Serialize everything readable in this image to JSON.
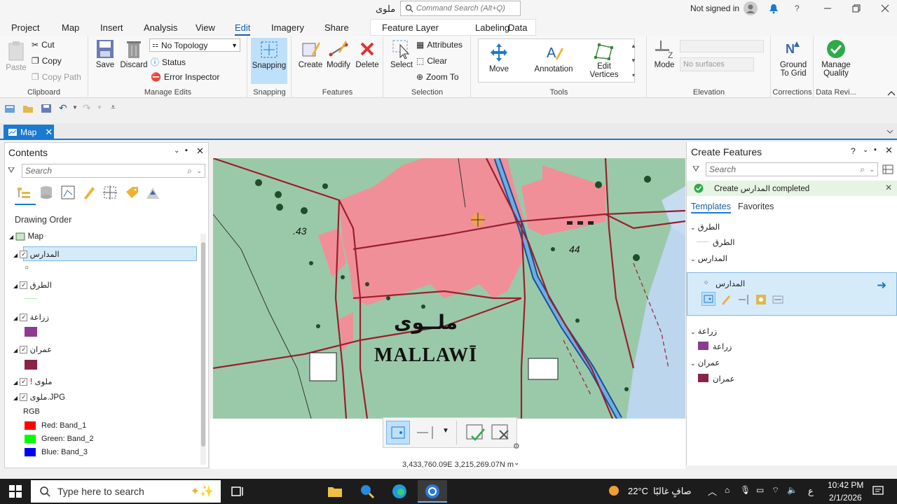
{
  "title": {
    "app_name": "ملوى",
    "search_placeholder": "Command Search (Alt+Q)",
    "account": "Not signed in",
    "help": "?"
  },
  "menu": {
    "tabs": [
      "Project",
      "Map",
      "Insert",
      "Analysis",
      "View",
      "Edit",
      "Imagery",
      "Share"
    ],
    "context_tabs": [
      "Feature Layer",
      "Labeling",
      "Data"
    ]
  },
  "ribbon": {
    "clipboard": {
      "paste": "Paste",
      "cut": "Cut",
      "copy": "Copy",
      "copy_path": "Copy Path",
      "label": "Clipboard"
    },
    "manage_edits": {
      "save": "Save",
      "discard": "Discard",
      "topology": "No Topology",
      "status": "Status",
      "error_inspector": "Error Inspector",
      "label": "Manage Edits"
    },
    "snapping": {
      "button": "Snapping",
      "label": "Snapping"
    },
    "features": {
      "create": "Create",
      "modify": "Modify",
      "delete": "Delete",
      "label": "Features"
    },
    "selection": {
      "select": "Select",
      "attributes": "Attributes",
      "clear": "Clear",
      "zoom_to": "Zoom To",
      "label": "Selection"
    },
    "tools": {
      "move": "Move",
      "annotation": "Annotation",
      "edit_vertices_1": "Edit",
      "edit_vertices_2": "Vertices",
      "label": "Tools"
    },
    "elevation": {
      "mode": "Mode",
      "surfaces": "No surfaces",
      "label": "Elevation"
    },
    "corrections": {
      "ground_1": "Ground",
      "ground_2": "To Grid",
      "label": "Corrections"
    },
    "data_review": {
      "manage_1": "Manage",
      "manage_2": "Quality",
      "label": "Data Revi..."
    }
  },
  "doc_tab": {
    "label": "Map"
  },
  "contents": {
    "title": "Contents",
    "search_placeholder": "Search",
    "drawing_order": "Drawing Order",
    "map_label": "Map",
    "layers": [
      {
        "name": "المدارس"
      },
      {
        "name": "الطرق"
      },
      {
        "name": "زراعة"
      },
      {
        "name": "عمران"
      },
      {
        "name": "ملوى"
      },
      {
        "name": "ملوى.JPG"
      }
    ],
    "rgb_label": "RGB",
    "bands": [
      "Red:  Band_1",
      "Green: Band_2",
      "Blue:  Band_3"
    ]
  },
  "map_labels": {
    "spot_43": ".43",
    "spot_44": "44",
    "town_ar": "ملــوى",
    "town_en": "MALLAWĪ"
  },
  "coords": "3,433,760.09E 3,215,269.07N m",
  "create_features": {
    "title": "Create Features",
    "search_placeholder": "Search",
    "notice": "Create المدارس completed",
    "tab_templates": "Templates",
    "tab_favorites": "Favorites",
    "groups": [
      {
        "header": "الطرق",
        "item": "الطرق"
      },
      {
        "header": "المدارس",
        "item": "المدارس"
      },
      {
        "header": "زراعة",
        "item": "زراعة"
      },
      {
        "header": "عمران",
        "item": "عمران"
      }
    ]
  },
  "taskbar": {
    "search_text": "Type here to search",
    "temperature": "22°C",
    "weather": "صافٍ غالبًا",
    "time": "10:42 PM",
    "date": "2/1/2026",
    "lang": "ع"
  },
  "colors": {
    "accent": "#1a7ad0",
    "zraa": "#8e3b8e",
    "omran": "#8a2346",
    "urban_map": "#f08f97",
    "map_bg": "#9ac9a9"
  }
}
